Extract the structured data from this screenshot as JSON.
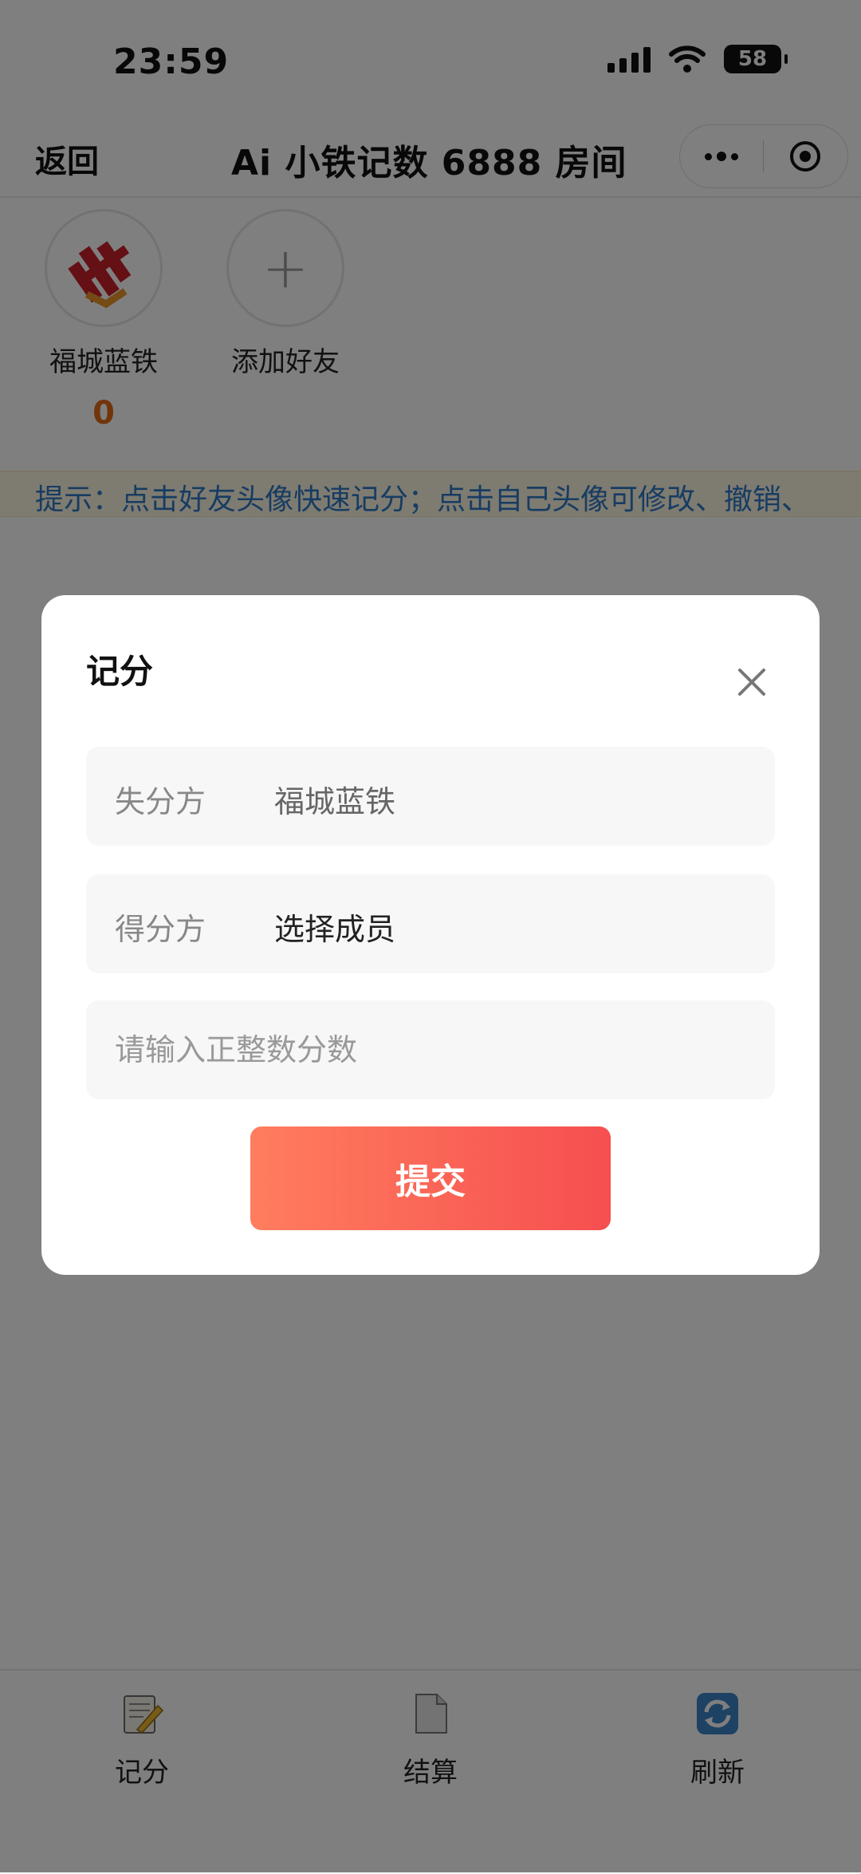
{
  "status_bar": {
    "time": "23:59",
    "battery": "58",
    "icons": [
      "signal-icon",
      "wifi-icon",
      "battery-icon"
    ]
  },
  "nav": {
    "back_label": "返回",
    "title": "Ai 小铁记数 6888 房间",
    "capsule_icons": [
      "more-icon",
      "close-miniprogram-icon"
    ]
  },
  "members": [
    {
      "name": "福城蓝铁",
      "score": "0",
      "avatar_icon": "logo-avatar"
    },
    {
      "name": "添加好友",
      "avatar_icon": "plus-icon"
    }
  ],
  "tip": {
    "text": "提示：点击好友头像快速记分；点击自己头像可修改、撤销、"
  },
  "dialog": {
    "title": "记分",
    "loser_label": "失分方",
    "loser_value": "福城蓝铁",
    "winner_label": "得分方",
    "winner_value": "选择成员",
    "score_placeholder": "请输入正整数分数",
    "score_value": "",
    "submit_label": "提交",
    "submit_colors": [
      "#ff7d5f",
      "#f64f4f"
    ]
  },
  "tab_bar": {
    "tabs": [
      {
        "label": "记分",
        "icon": "notepad-pencil-icon"
      },
      {
        "label": "结算",
        "icon": "document-icon"
      },
      {
        "label": "刷新",
        "icon": "refresh-icon"
      }
    ]
  },
  "colors": {
    "score_orange": "#e36a16",
    "tip_blue": "#2f78c4",
    "tip_bg": "#fdf6e3"
  }
}
